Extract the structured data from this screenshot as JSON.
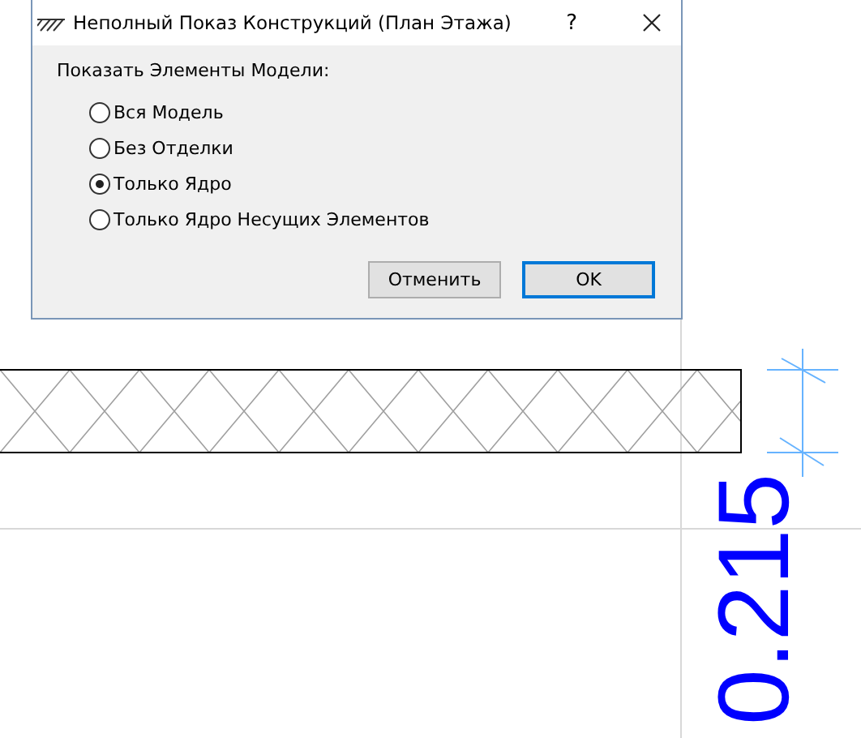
{
  "dialog": {
    "title": "Неполный Показ Конструкций (План Этажа)",
    "help": "?",
    "group_label": "Показать Элементы Модели:",
    "options": [
      {
        "label": "Вся Модель",
        "selected": false
      },
      {
        "label": "Без Отделки",
        "selected": false
      },
      {
        "label": "Только Ядро",
        "selected": true
      },
      {
        "label": "Только Ядро Несущих Элементов",
        "selected": false
      }
    ],
    "buttons": [
      {
        "label": "Отменить",
        "kind": "normal"
      },
      {
        "label": "OK",
        "kind": "default"
      }
    ]
  },
  "drawing": {
    "dimension": "0.215"
  }
}
